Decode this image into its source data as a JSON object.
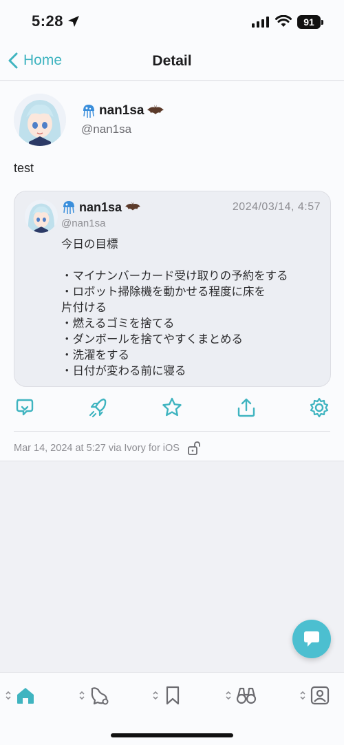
{
  "status_bar": {
    "time": "5:28",
    "battery": "91"
  },
  "nav": {
    "back_label": "Home",
    "title": "Detail"
  },
  "post": {
    "author_name": "nan1sa",
    "author_handle": "@nan1sa",
    "text": "test",
    "quoted": {
      "author_name": "nan1sa",
      "author_handle": "@nan1sa",
      "date": "2024/03/14, 4:57",
      "body": "今日の目標\n\n・マイナンバーカード受け取りの予約をする\n・ロボット掃除機を動かせる程度に床を\n片付ける\n・燃えるゴミを捨てる\n・ダンボールを捨てやすくまとめる\n・洗濯をする\n・日付が変わる前に寝る"
    },
    "meta": "Mar 14, 2024 at 5:27 via Ivory for iOS"
  },
  "actions": [
    "reply-icon",
    "boost-icon",
    "favorite-icon",
    "share-icon",
    "more-icon"
  ],
  "tabs": [
    "home-icon",
    "notifications-icon",
    "bookmarks-icon",
    "explore-icon",
    "profile-icon"
  ],
  "colors": {
    "accent": "#3fb4c0",
    "fab": "#4cbfd0"
  }
}
